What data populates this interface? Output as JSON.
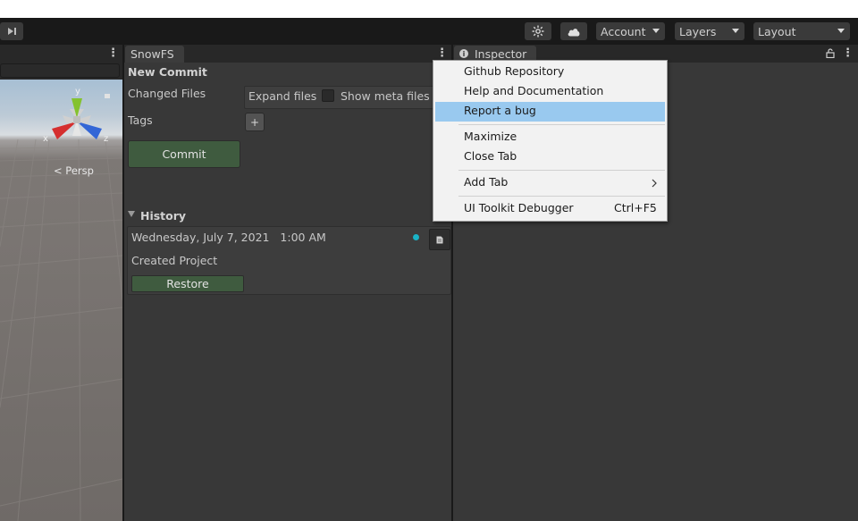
{
  "toolbar": {
    "account_label": "Account",
    "layers_label": "Layers",
    "layout_label": "Layout"
  },
  "scene": {
    "view_mode": "< Persp",
    "gizmo_axes": [
      "y",
      "x",
      "z"
    ]
  },
  "snowfs": {
    "tab_label": "SnowFS",
    "new_commit_heading": "New Commit",
    "changed_files_label": "Changed Files",
    "expand_files_label": "Expand files",
    "show_meta_files_label": "Show meta files",
    "show_meta_files_checked": false,
    "tags_label": "Tags",
    "add_tag_label": "+",
    "commit_label": "Commit",
    "history_heading": "History",
    "history": [
      {
        "date": "Wednesday, July 7, 2021",
        "time": "1:00 AM",
        "message": "Created Project",
        "restore_label": "Restore"
      }
    ]
  },
  "inspector": {
    "tab_label": "Inspector"
  },
  "context_menu": {
    "items": [
      {
        "label": "Github Repository"
      },
      {
        "label": "Help and Documentation"
      },
      {
        "label": "Report a bug",
        "highlighted": true
      },
      {
        "label": "Maximize"
      },
      {
        "label": "Close Tab"
      },
      {
        "label": "Add Tab",
        "submenu": true
      },
      {
        "label": "UI Toolkit Debugger",
        "shortcut": "Ctrl+F5"
      }
    ]
  },
  "colors": {
    "accent_green": "#3f5b3f",
    "menu_highlight": "#99c9ef",
    "status_dot": "#1ab3c6"
  }
}
